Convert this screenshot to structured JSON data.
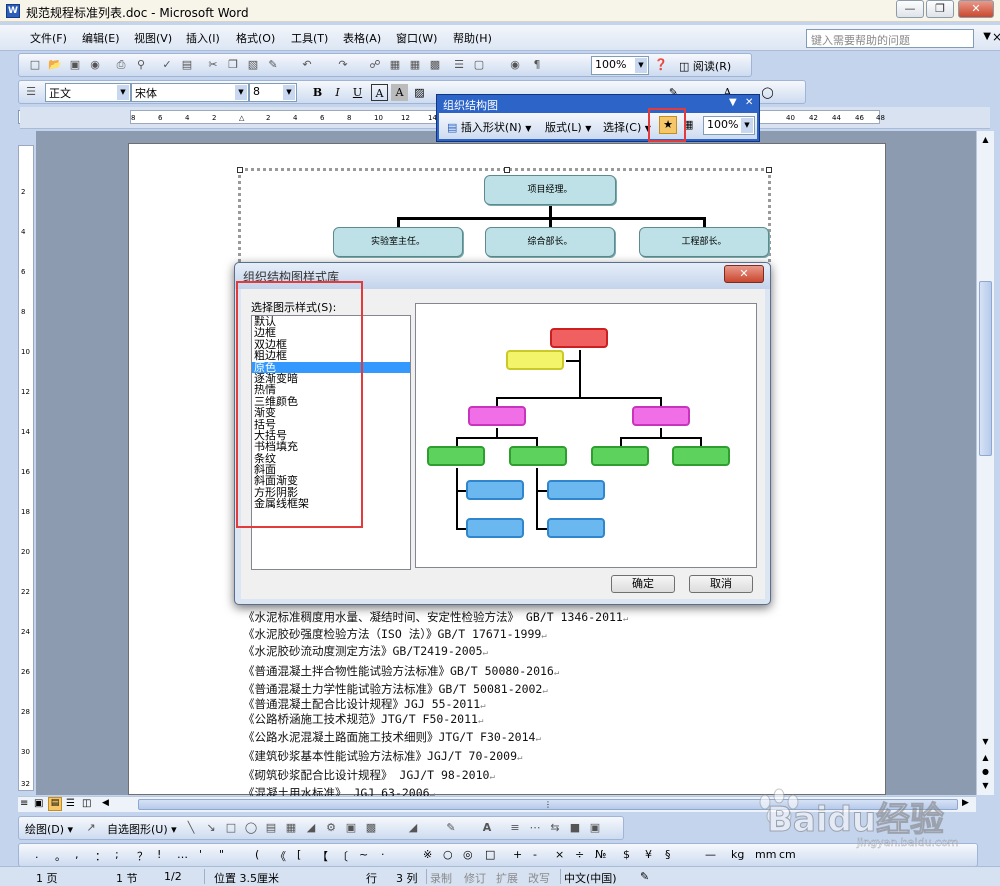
{
  "window": {
    "title": "规范规程标准列表.doc - Microsoft Word",
    "icon": "word-doc-icon"
  },
  "menu": {
    "items": [
      "文件(F)",
      "编辑(E)",
      "视图(V)",
      "插入(I)",
      "格式(O)",
      "工具(T)",
      "表格(A)",
      "窗口(W)",
      "帮助(H)"
    ],
    "help_placeholder": "键入需要帮助的问题"
  },
  "standard_toolbar": {
    "zoom": "100%",
    "read_label": "阅读(R)"
  },
  "formatting_toolbar": {
    "style": "正文",
    "font": "宋体",
    "size": "8"
  },
  "ruler": {
    "labels": [
      "8",
      "6",
      "4",
      "2",
      "",
      "2",
      "4",
      "6",
      "8",
      "10",
      "12",
      "14",
      "",
      "",
      "",
      "",
      "",
      "",
      "",
      "",
      "",
      "",
      "",
      "",
      "",
      "",
      "40",
      "42",
      "44",
      "46",
      "48"
    ]
  },
  "vruler": {
    "labels": [
      "2",
      "4",
      "6",
      "8",
      "10",
      "12",
      "14",
      "16",
      "18",
      "20",
      "22",
      "24",
      "26",
      "28",
      "30",
      "32"
    ]
  },
  "orgchart_toolbar": {
    "title": "组织结构图",
    "insert_shape": "插入形状(N)",
    "layout": "版式(L)",
    "select": "选择(C)",
    "zoom": "100%"
  },
  "org_chart": {
    "top": "项目经理。",
    "children": [
      "实验室主任。",
      "综合部长。",
      "工程部长。"
    ]
  },
  "dialog": {
    "title": "组织结构图样式库",
    "list_label": "选择图示样式(S):",
    "styles": [
      "默认",
      "边框",
      "双边框",
      "粗边框",
      "原色",
      "逐渐变暗",
      "热情",
      "三维颜色",
      "渐变",
      "括号",
      "大括号",
      "书档填充",
      "条纹",
      "斜面",
      "斜面渐变",
      "方形阴影",
      "金属线框架"
    ],
    "selected": "原色",
    "ok": "确定",
    "cancel": "取消",
    "preview_colors": {
      "top": "#f06060",
      "assistant": "#f4f46a",
      "level2": "#f06ee6",
      "level3": "#5dd35d",
      "level4": "#6bb7f0"
    }
  },
  "document_lines": [
    "《水泥标准稠度用水量、凝结时间、安定性检验方法》 GB/T 1346-2011",
    "《水泥胶砂强度检验方法（ISO 法）》GB/T 17671-1999",
    "《水泥胶砂流动度测定方法》GB/T2419-2005",
    "《普通混凝土拌合物性能试验方法标准》GB/T 50080-2016",
    "《普通混凝土力学性能试验方法标准》GB/T 50081-2002",
    "《普通混凝土配合比设计规程》JGJ 55-2011",
    "《公路桥涵施工技术规范》JTG/T F50-2011",
    "《公路水泥混凝土路面施工技术细则》JTG/T F30-2014",
    "《建筑砂浆基本性能试验方法标准》JGJ/T 70-2009",
    "《砌筑砂浆配合比设计规程》  JGJ/T 98-2010",
    "《混凝土用水标准》 JGJ 63-2006"
  ],
  "drawing_toolbar": {
    "draw": "绘图(D)",
    "autoshapes": "自选图形(U)"
  },
  "symbol_bar": {
    "symbols": [
      ".",
      "。",
      ",",
      "：",
      ";",
      "？",
      "!",
      "…",
      "'",
      "\"",
      "(",
      "《",
      "[",
      "【",
      "〔",
      "~",
      "·",
      "※",
      "○",
      "◎",
      "□",
      "+",
      "-",
      "×",
      "÷",
      "№",
      "$",
      "¥",
      "§",
      "—",
      "kg",
      "mm",
      "cm"
    ]
  },
  "statusbar": {
    "page": "1 页",
    "section": "1 节",
    "pages": "1/2",
    "position": "位置 3.5厘米",
    "line": "行",
    "col": "3 列",
    "rec": "录制",
    "trk": "修订",
    "ext": "扩展",
    "ovr": "改写",
    "lang": "中文(中国)"
  },
  "watermark": {
    "brand": "Baidu经验",
    "url": "jingyan.baidu.com"
  }
}
